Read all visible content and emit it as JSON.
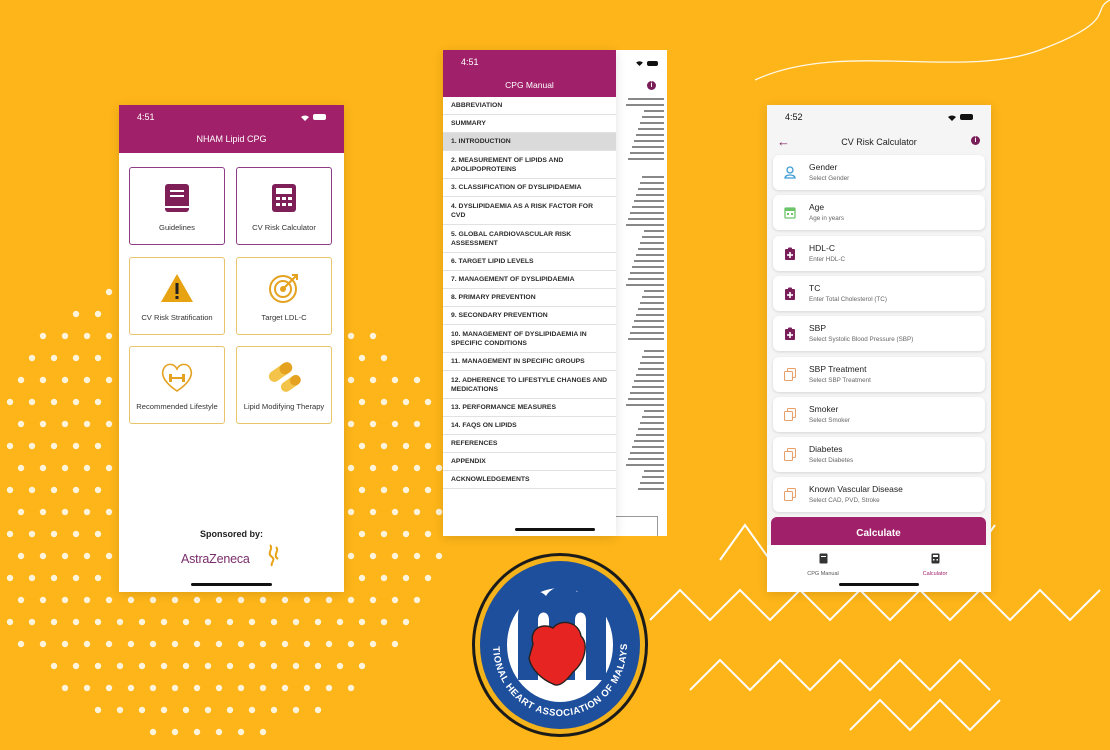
{
  "colors": {
    "background": "#FDB519",
    "brand": "#A0216A",
    "accent_gold": "#D99A0C"
  },
  "phone1": {
    "status_time": "4:51",
    "app_title": "NHAM Lipid CPG",
    "tiles": [
      {
        "label": "Guidelines",
        "icon": "book-icon"
      },
      {
        "label": "CV Risk Calculator",
        "icon": "calculator-icon"
      },
      {
        "label": "CV Risk Stratification",
        "icon": "warning-icon"
      },
      {
        "label": "Target LDL-C",
        "icon": "target-icon"
      },
      {
        "label": "Recommended Lifestyle",
        "icon": "heart-dumbbell-icon"
      },
      {
        "label": "Lipid Modifying Therapy",
        "icon": "capsule-icon"
      }
    ],
    "sponsored_by": "Sponsored by:",
    "sponsor_name": "AstraZeneca"
  },
  "phone2": {
    "status_time": "4:51",
    "title": "CPG Manual",
    "menu": [
      "ABBREVIATION",
      "SUMMARY",
      "1. INTRODUCTION",
      "2. MEASUREMENT OF LIPIDS AND APOLIPOPROTEINS",
      "3. CLASSIFICATION OF DYSLIPIDAEMIA",
      "4. DYSLIPIDAEMIA AS A RISK FACTOR FOR CVD",
      "5. GLOBAL CARDIOVASCULAR RISK ASSESSMENT",
      "6. TARGET LIPID LEVELS",
      "7. MANAGEMENT OF DYSLIPIDAEMIA",
      "8. PRIMARY PREVENTION",
      "9. SECONDARY PREVENTION",
      "10. MANAGEMENT OF DYSLIPIDAEMIA IN SPECIFIC CONDITIONS",
      "11. MANAGEMENT IN SPECIFIC GROUPS",
      "12. ADHERENCE TO LIFESTYLE CHANGES AND MEDICATIONS",
      "13. PERFORMANCE MEASURES",
      "14. FAQS ON LIPIDS",
      "REFERENCES",
      "APPENDIX",
      "ACKNOWLEDGEMENTS"
    ],
    "active_item": "1. INTRODUCTION"
  },
  "phone3": {
    "status_time": "4:52",
    "title": "CV Risk Calculator",
    "fields": [
      {
        "label": "Gender",
        "sub": "Select Gender",
        "icon": "person-icon"
      },
      {
        "label": "Age",
        "sub": "Age in years",
        "icon": "calendar-icon"
      },
      {
        "label": "HDL-C",
        "sub": "Enter HDL-C",
        "icon": "clipboard-plus-icon"
      },
      {
        "label": "TC",
        "sub": "Enter Total Cholesterol (TC)",
        "icon": "clipboard-plus-icon"
      },
      {
        "label": "SBP",
        "sub": "Select Systolic Blood Pressure (SBP)",
        "icon": "clipboard-plus-icon"
      },
      {
        "label": "SBP Treatment",
        "sub": "Select SBP Treatment",
        "icon": "copy-icon"
      },
      {
        "label": "Smoker",
        "sub": "Select Smoker",
        "icon": "copy-icon"
      },
      {
        "label": "Diabetes",
        "sub": "Select Diabetes",
        "icon": "copy-icon"
      },
      {
        "label": "Known Vascular Disease",
        "sub": "Select CAD, PVD, Stroke",
        "icon": "copy-icon"
      }
    ],
    "calculate_label": "Calculate",
    "tabs": [
      {
        "label": "CPG Manual",
        "icon": "book-icon"
      },
      {
        "label": "Calculator",
        "icon": "calculator-icon"
      }
    ],
    "active_tab": "Calculator"
  },
  "logo": {
    "text": "NATIONAL HEART ASSOCIATION OF MALAYSIA",
    "letter": "m"
  }
}
